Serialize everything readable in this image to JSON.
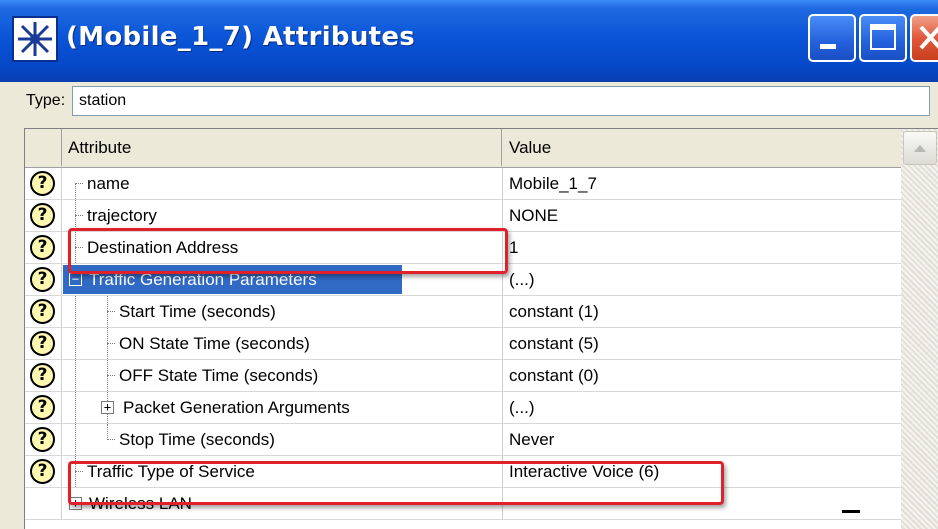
{
  "window": {
    "title": "(Mobile_1_7) Attributes"
  },
  "type_row": {
    "label": "Type:",
    "value": "station"
  },
  "grid": {
    "headers": {
      "attribute": "Attribute",
      "value": "Value"
    },
    "rows": [
      {
        "attribute": "name",
        "value": "Mobile_1_7"
      },
      {
        "attribute": "trajectory",
        "value": "NONE"
      },
      {
        "attribute": "Destination Address",
        "value": "1"
      },
      {
        "attribute": "Traffic Generation Parameters",
        "value": "(...)"
      },
      {
        "attribute": "Start Time (seconds)",
        "value": "constant (1)"
      },
      {
        "attribute": "ON State Time (seconds)",
        "value": "constant (5)"
      },
      {
        "attribute": "OFF State Time (seconds)",
        "value": "constant (0)"
      },
      {
        "attribute": "Packet Generation Arguments",
        "value": "(...)"
      },
      {
        "attribute": "Stop Time (seconds)",
        "value": "Never"
      },
      {
        "attribute": "Traffic Type of Service",
        "value": "Interactive Voice (6)"
      },
      {
        "attribute": "Wireless LAN",
        "value": ""
      }
    ]
  },
  "colors": {
    "title_bar": "#0a55d8",
    "selection": "#316ac5",
    "highlight_box": "#e0202a",
    "help_icon_fill": "#fff8b0"
  },
  "icons": {
    "app": "star-app-icon",
    "minimize": "minimize-icon",
    "maximize": "maximize-icon",
    "close": "close-icon",
    "help": "question-help-icon",
    "expand": "expand-plus-icon",
    "collapse": "collapse-minus-icon",
    "scroll_up": "scroll-up-arrow-icon"
  },
  "help_glyph": "?",
  "expander_glyphs": {
    "collapse": "−",
    "expand": "+"
  }
}
